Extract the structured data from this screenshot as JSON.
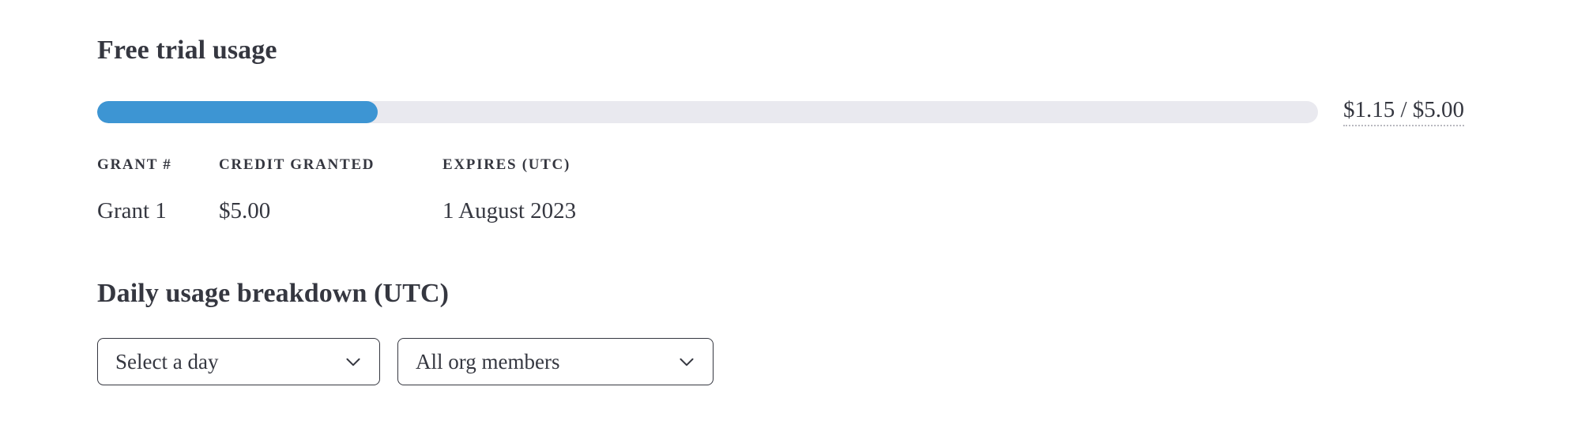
{
  "colors": {
    "text": "#353740",
    "progress_fill": "#3d95d3",
    "progress_track": "#e9e9ef",
    "border": "#353740",
    "background": "#ffffff"
  },
  "free_trial": {
    "title": "Free trial usage",
    "progress": {
      "used_amount": "$1.15",
      "total_amount": "$5.00",
      "label": "$1.15 / $5.00",
      "percent": 23
    },
    "grants_table": {
      "columns": [
        "GRANT #",
        "CREDIT GRANTED",
        "EXPIRES (UTC)"
      ],
      "rows": [
        {
          "grant": "Grant 1",
          "credit_granted": "$5.00",
          "expires": "1 August 2023"
        }
      ]
    }
  },
  "daily_usage": {
    "title": "Daily usage breakdown (UTC)",
    "day_select": {
      "value": "Select a day",
      "icon": "chevron-down-icon"
    },
    "members_select": {
      "value": "All org members",
      "icon": "chevron-down-icon"
    }
  }
}
